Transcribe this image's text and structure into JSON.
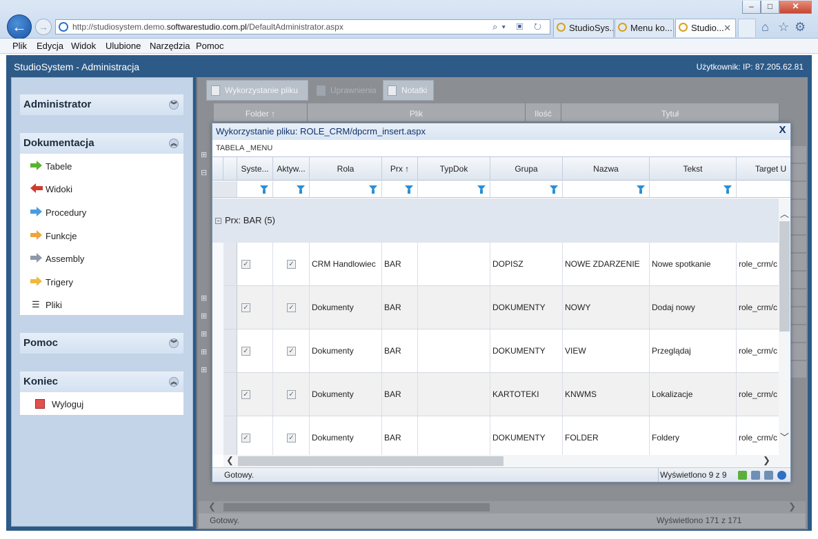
{
  "browser": {
    "url_prefix": "http://studiosystem.demo.",
    "url_domain": "softwarestudio.com.pl",
    "url_path": "/DefaultAdministrator.aspx",
    "tabs": [
      {
        "label": "StudioSys..."
      },
      {
        "label": "Menu ko..."
      },
      {
        "label": "Studio..."
      }
    ],
    "menu": [
      "Plik",
      "Edycja",
      "Widok",
      "Ulubione",
      "Narzędzia",
      "Pomoc"
    ]
  },
  "app": {
    "title": "StudioSystem - Administracja",
    "user_info": "Użytkownik: IP: 87.205.62.81"
  },
  "sidebar": {
    "sections": [
      {
        "title": "Administrator"
      },
      {
        "title": "Dokumentacja"
      },
      {
        "title": "Pomoc"
      },
      {
        "title": "Koniec"
      }
    ],
    "doc_items": [
      {
        "label": "Tabele",
        "icon": "arrow-right-green-icon",
        "color": "#58b32f"
      },
      {
        "label": "Widoki",
        "icon": "arrow-left-red-icon",
        "color": "#d23b2b"
      },
      {
        "label": "Procedury",
        "icon": "arrow-right-blue-icon",
        "color": "#4b9be0"
      },
      {
        "label": "Funkcje",
        "icon": "arrow-right-orange-icon",
        "color": "#efa43b"
      },
      {
        "label": "Assembly",
        "icon": "arrow-right-gray-icon",
        "color": "#8d99a8"
      },
      {
        "label": "Trigery",
        "icon": "arrow-right-yellow-icon",
        "color": "#efb93b"
      },
      {
        "label": "Pliki",
        "icon": "list-icon"
      }
    ],
    "logout_label": "Wyloguj"
  },
  "main": {
    "toolbar": {
      "usage": "Wykorzystanie pliku",
      "permissions": "Uprawnienia",
      "notes": "Notatki"
    },
    "columns": [
      "Folder ↑",
      "Plik",
      "Ilość",
      "Tytuł"
    ],
    "status": "Gotowy.",
    "count": "Wyświetlono 171 z 171"
  },
  "modal": {
    "title": "Wykorzystanie pliku: ROLE_CRM/dpcrm_insert.aspx",
    "close": "X",
    "subtitle": "TABELA _MENU",
    "columns": [
      "Syste...",
      "Aktyw...",
      "Rola",
      "Prx ↑",
      "TypDok",
      "Grupa",
      "Nazwa",
      "Tekst",
      "Target U"
    ],
    "group_label": "Prx: BAR (5)",
    "rows": [
      {
        "system": true,
        "active": true,
        "rola": "CRM Handlowiec",
        "prx": "BAR",
        "typdok": "",
        "grupa": "DOPISZ",
        "nazwa": "NOWE ZDARZENIE",
        "tekst": "Nowe spotkanie",
        "target": "role_crm/c"
      },
      {
        "system": true,
        "active": true,
        "rola": "Dokumenty",
        "prx": "BAR",
        "typdok": "",
        "grupa": "DOKUMENTY",
        "nazwa": "NOWY",
        "tekst": "Dodaj nowy",
        "target": "role_crm/c"
      },
      {
        "system": true,
        "active": true,
        "rola": "Dokumenty",
        "prx": "BAR",
        "typdok": "",
        "grupa": "DOKUMENTY",
        "nazwa": "VIEW",
        "tekst": "Przeglądaj",
        "target": "role_crm/c"
      },
      {
        "system": true,
        "active": true,
        "rola": "Dokumenty",
        "prx": "BAR",
        "typdok": "",
        "grupa": "KARTOTEKI",
        "nazwa": "KNWMS",
        "tekst": "Lokalizacje",
        "target": "role_crm/c"
      },
      {
        "system": true,
        "active": true,
        "rola": "Dokumenty",
        "prx": "BAR",
        "typdok": "",
        "grupa": "DOKUMENTY",
        "nazwa": "FOLDER",
        "tekst": "Foldery",
        "target": "role_crm/c"
      }
    ],
    "status": "Gotowy.",
    "count": "Wyświetlono 9 z 9"
  }
}
